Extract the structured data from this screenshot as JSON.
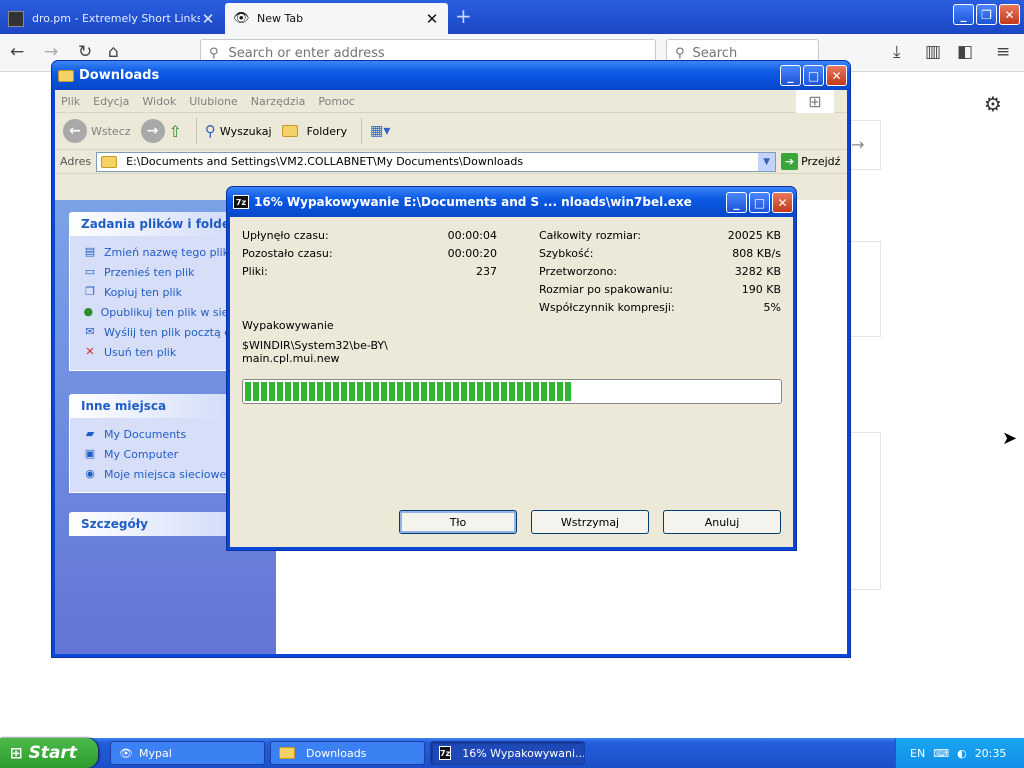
{
  "browser": {
    "tabs": [
      {
        "label": "dro.pm - Extremely Short Links",
        "close": "✕"
      },
      {
        "label": "New Tab",
        "close": "✕"
      }
    ],
    "new_tab": "+",
    "url_placeholder": "Search or enter address",
    "search_placeholder": "Search"
  },
  "explorer": {
    "title": "Downloads",
    "menu": [
      "Plik",
      "Edycja",
      "Widok",
      "Ulubione",
      "Narzędzia",
      "Pomoc"
    ],
    "toolbar": {
      "back": "Wstecz",
      "search": "Wyszukaj",
      "folders": "Foldery"
    },
    "address_label": "Adres",
    "address_value": "E:\\Documents and Settings\\VM2.COLLABNET\\My Documents\\Downloads",
    "go_label": "Przejdź",
    "file_tasks": {
      "header": "Zadania plików i folderów",
      "items": [
        "Zmień nazwę tego pliku",
        "Przenieś ten plik",
        "Kopiuj ten plik",
        "Opublikuj ten plik w sieci Web",
        "Wyślij ten plik pocztą e-mail",
        "Usuń ten plik"
      ]
    },
    "other_places": {
      "header": "Inne miejsca",
      "items": [
        "My Documents",
        "My Computer",
        "Moje miejsca sieciowe"
      ]
    },
    "details": {
      "header": "Szczegóły"
    }
  },
  "dialog": {
    "title": "16% Wypakowywanie E:\\Documents and S ... nloads\\win7bel.exe",
    "left_stats": [
      {
        "label": "Upłynęło czasu:",
        "value": "00:00:04"
      },
      {
        "label": "Pozostało czasu:",
        "value": "00:00:20"
      },
      {
        "label": "Pliki:",
        "value": "237"
      }
    ],
    "right_stats": [
      {
        "label": "Całkowity rozmiar:",
        "value": "20025 KB"
      },
      {
        "label": "Szybkość:",
        "value": "808 KB/s"
      },
      {
        "label": "Przetworzono:",
        "value": "3282 KB"
      },
      {
        "label": "Rozmiar po spakowaniu:",
        "value": "190 KB"
      },
      {
        "label": "Współczynnik kompresji:",
        "value": "5%"
      }
    ],
    "operation": "Wypakowywanie",
    "current_path": "$WINDIR\\System32\\be-BY\\",
    "current_file": "main.cpl.mui.new",
    "progress_percent": 61,
    "buttons": {
      "background": "Tło",
      "pause": "Wstrzymaj",
      "cancel": "Anuluj"
    }
  },
  "taskbar": {
    "start": "Start",
    "items": [
      {
        "label": "Mypal"
      },
      {
        "label": "Downloads"
      },
      {
        "label": "16% Wypakowywani..."
      }
    ],
    "lang": "EN",
    "clock": "20:35"
  },
  "colors": {
    "xp_blue": "#0a47d6",
    "progress_green": "#2fb52f",
    "link_blue": "#215dc6"
  }
}
